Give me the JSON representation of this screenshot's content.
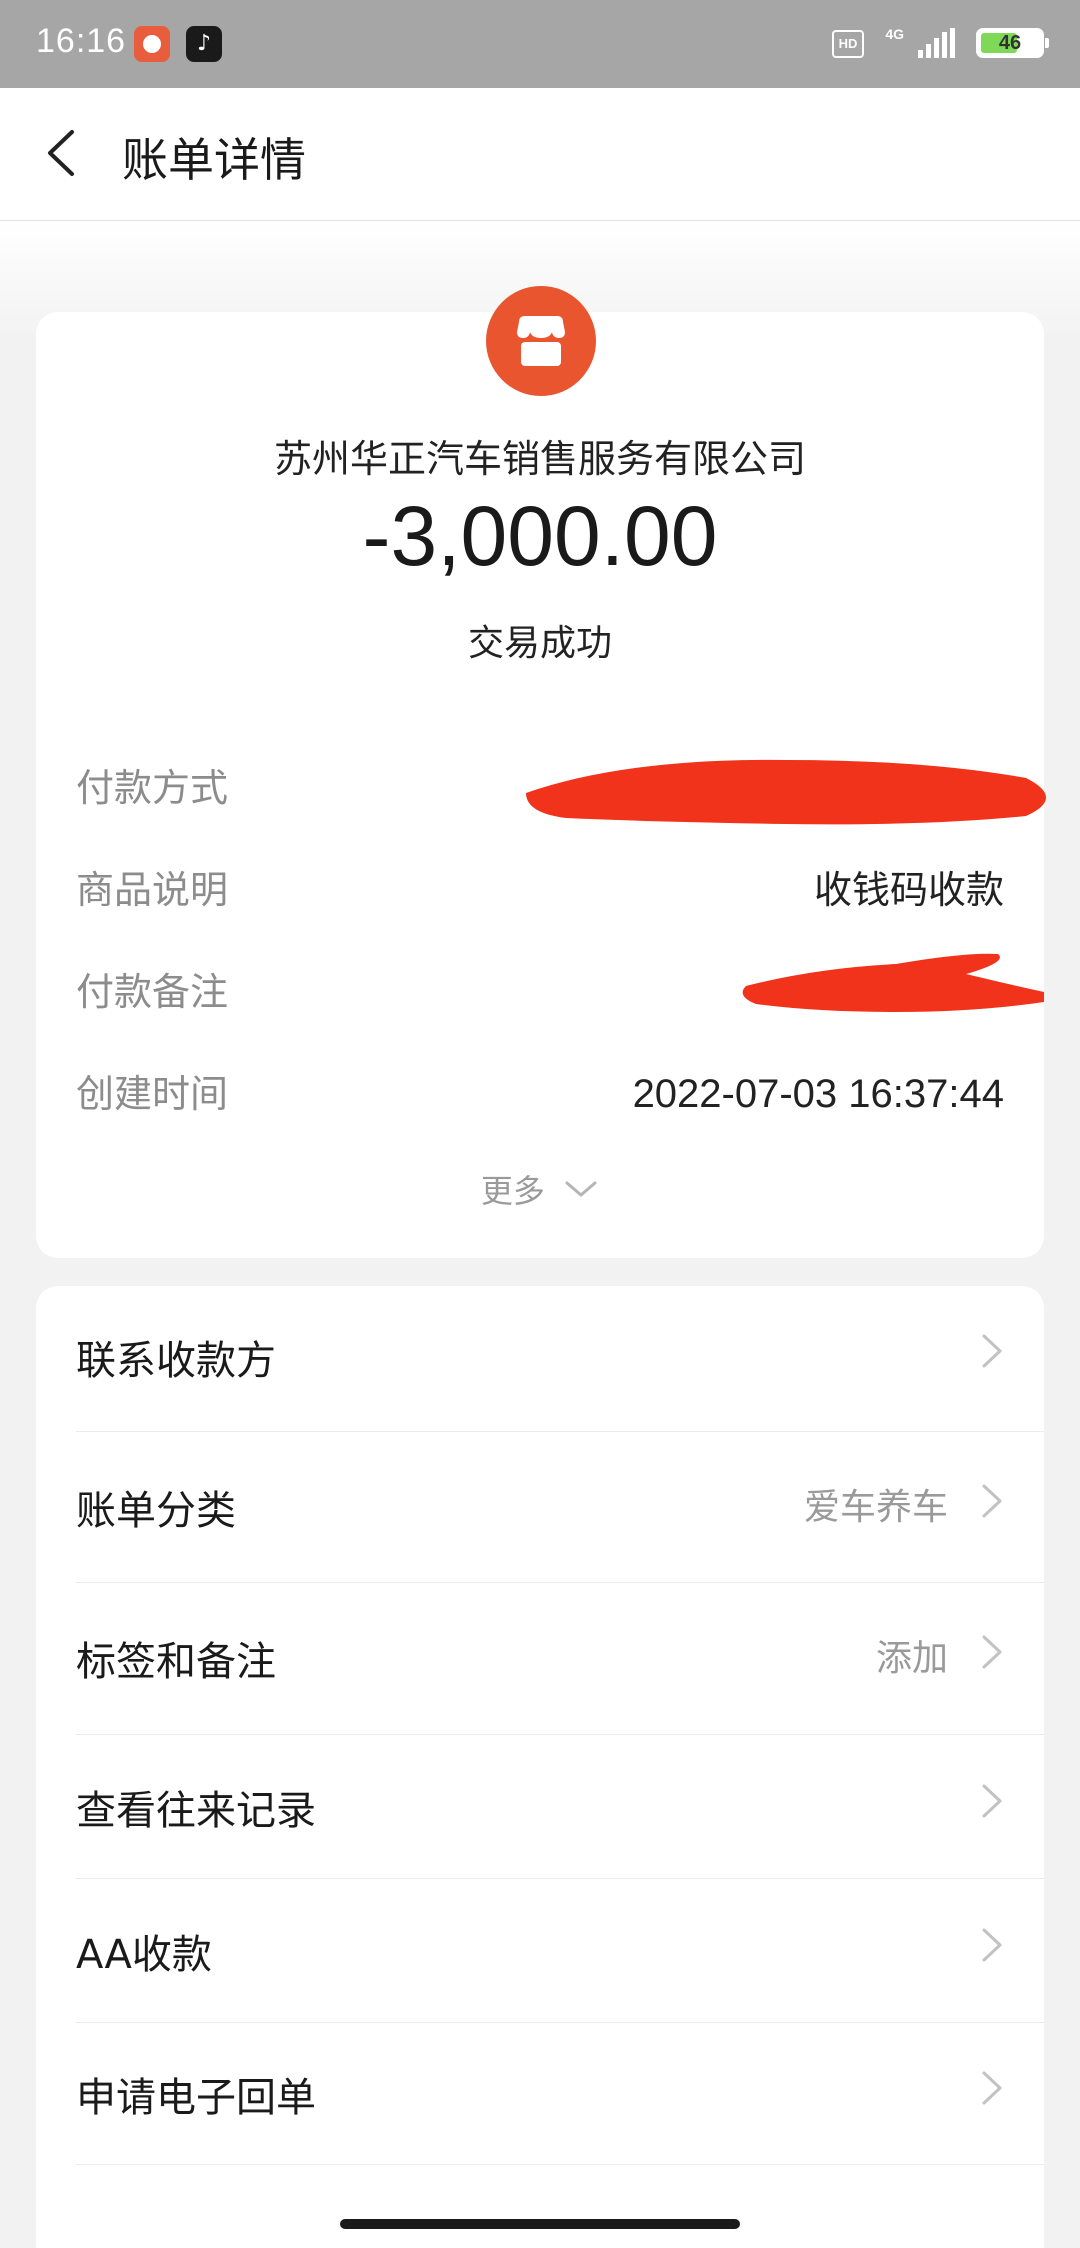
{
  "status_bar": {
    "time": "16:16",
    "network": "4G",
    "hd": "HD",
    "battery": "46"
  },
  "header": {
    "title": "账单详情"
  },
  "summary": {
    "merchant": "苏州华正汽车销售服务有限公司",
    "amount": "-3,000.00",
    "status": "交易成功",
    "details": [
      {
        "label": "付款方式",
        "value": ""
      },
      {
        "label": "商品说明",
        "value": "收钱码收款"
      },
      {
        "label": "付款备注",
        "value": ""
      },
      {
        "label": "创建时间",
        "value": "2022-07-03 16:37:44"
      }
    ],
    "more_label": "更多"
  },
  "actions": [
    {
      "label": "联系收款方",
      "value": ""
    },
    {
      "label": "账单分类",
      "value": "爱车养车"
    },
    {
      "label": "标签和备注",
      "value": "添加"
    },
    {
      "label": "查看往来记录",
      "value": ""
    },
    {
      "label": "AA收款",
      "value": ""
    },
    {
      "label": "申请电子回单",
      "value": ""
    }
  ],
  "colors": {
    "accent": "#e8552e",
    "redaction": "#f0331a",
    "status_bar": "#a6a6a6",
    "background": "#f2f2f2"
  }
}
